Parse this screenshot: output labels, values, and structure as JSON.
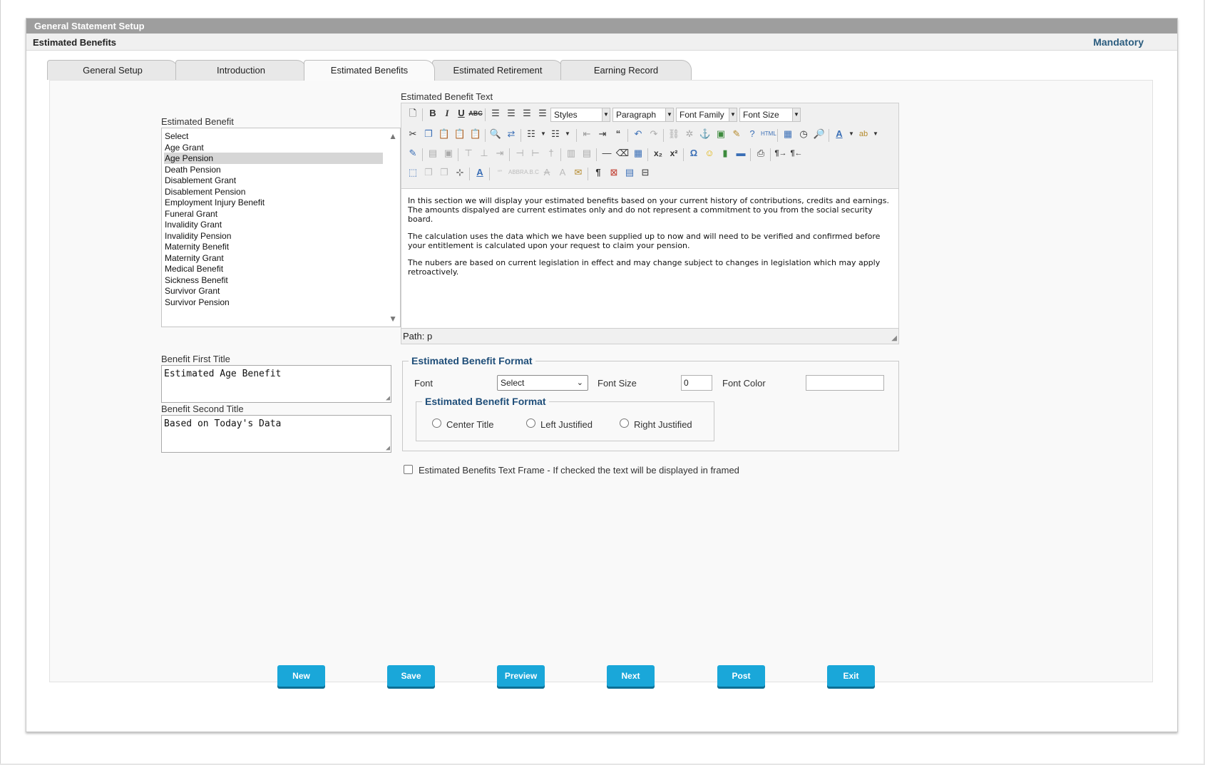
{
  "window": {
    "title": "General Statement Setup",
    "page_title": "Estimated Benefits",
    "mandatory_label": "Mandatory"
  },
  "tabs": [
    {
      "label": "General Setup",
      "active": false
    },
    {
      "label": "Introduction",
      "active": false
    },
    {
      "label": "Estimated Benefits",
      "active": true
    },
    {
      "label": "Estimated Retirement",
      "active": false
    },
    {
      "label": "Earning Record",
      "active": false
    }
  ],
  "benefit_list": {
    "label": "Estimated Benefit",
    "selected": "Age Pension",
    "items": [
      "Select",
      "Age Grant",
      "Age Pension",
      "Death Pension",
      "Disablement Grant",
      "Disablement Pension",
      "Employment Injury Benefit",
      "Funeral Grant",
      "Invalidity Grant",
      "Invalidity Pension",
      "Maternity Benefit",
      "Maternity Grant",
      "Medical Benefit",
      "Sickness Benefit",
      "Survivor Grant",
      "Survivor Pension"
    ]
  },
  "first_title": {
    "label": "Benefit First Title",
    "value": "Estimated Age Benefit"
  },
  "second_title": {
    "label": "Benefit Second Title",
    "value": "Based on Today's Data"
  },
  "editor": {
    "label": "Estimated Benefit Text",
    "styles_select": "Styles",
    "paragraph_select": "Paragraph",
    "font_family_select": "Font Family",
    "font_size_select": "Font Size",
    "paragraphs": [
      "In this section we will display your estimated benefits based on your current history of contributions, credits and earnings. The amounts dispalyed are current estimates only and do not represent a commitment to you from the social security board.",
      "The calculation uses the data which we have been supplied up to now and will need to be verified and confirmed before your entitlement is calculated upon your request to claim your pension.",
      "The nubers are based on current legislation in effect and may change subject to changes in legislation which may apply retroactively."
    ],
    "path_text": "Path: p"
  },
  "format": {
    "legend": "Estimated Benefit Format",
    "font_label": "Font",
    "font_value": "Select",
    "font_size_label": "Font Size",
    "font_size_value": "0",
    "font_color_label": "Font Color",
    "font_color_value": "",
    "inner_legend": "Estimated Benefit Format",
    "radios": [
      "Center Title",
      "Left Justified",
      "Right Justified"
    ]
  },
  "frame_checkbox": {
    "label": "Estimated Benefits Text Frame - If checked the text will be displayed in framed",
    "checked": false
  },
  "buttons": {
    "new": "New",
    "save": "Save",
    "preview": "Preview",
    "next": "Next",
    "post": "Post",
    "exit": "Exit"
  },
  "colors": {
    "titlebar": "#9e9e9e",
    "mandatory": "#2b5c7e",
    "legend": "#1f4e79",
    "button": "#1aa7d9"
  }
}
